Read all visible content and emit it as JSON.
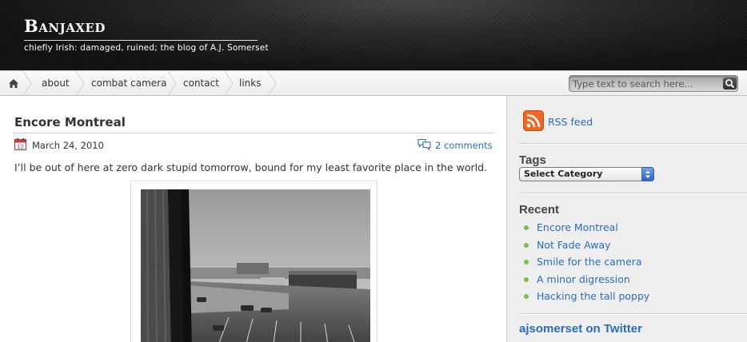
{
  "header": {
    "title": "Banjaxed",
    "description": "chiefly Irish: damaged, ruined; the blog of A.J. Somerset"
  },
  "nav": {
    "home_icon": "home-icon",
    "items": [
      {
        "label": "about"
      },
      {
        "label": "combat camera"
      },
      {
        "label": "contact"
      },
      {
        "label": "links"
      }
    ],
    "search_placeholder": "Type text to search here...",
    "search_icon": "magnifier-icon"
  },
  "post": {
    "title": "Encore Montreal",
    "date": "March 24, 2010",
    "comments": "2 comments",
    "body": "I’ll be out of here at zero dark stupid tomorrow, bound for my least favorite place in the world."
  },
  "sidebar": {
    "rss_label": "RSS feed",
    "tags_heading": "Tags",
    "category_select": "Select Category",
    "recent_heading": "Recent",
    "recent_items": [
      {
        "label": "Encore Montreal"
      },
      {
        "label": "Not Fade Away"
      },
      {
        "label": "Smile for the camera"
      },
      {
        "label": "A minor digression"
      },
      {
        "label": "Hacking the tall poppy"
      }
    ],
    "twitter_heading": "ajsomerset on Twitter"
  },
  "colors": {
    "link": "#2a6ebb",
    "bullet": "#7fbf3f",
    "rss": "#f26522"
  }
}
